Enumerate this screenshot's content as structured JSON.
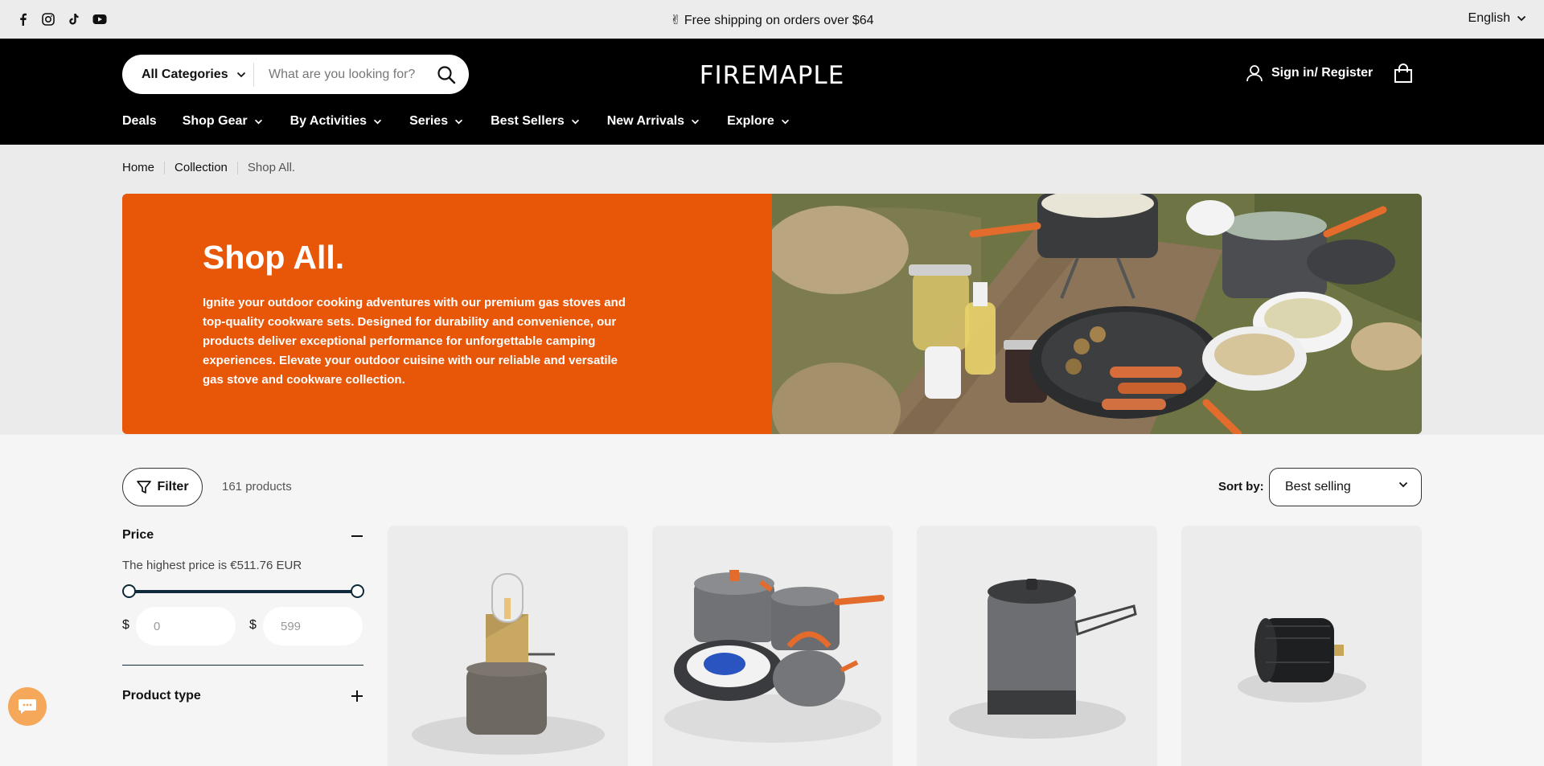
{
  "announcement": {
    "text": "Free shipping on orders over $64",
    "emoji": "✌"
  },
  "language": "English",
  "header": {
    "search": {
      "category": "All Categories",
      "placeholder": "What are you looking for?"
    },
    "logo": "FIREMAPLE",
    "account_label": "Sign in/ Register"
  },
  "nav": [
    {
      "label": "Deals"
    },
    {
      "label": "Shop Gear"
    },
    {
      "label": "By Activities"
    },
    {
      "label": "Series"
    },
    {
      "label": "Best Sellers"
    },
    {
      "label": "New Arrivals"
    },
    {
      "label": "Explore"
    }
  ],
  "breadcrumb": [
    "Home",
    "Collection",
    "Shop All."
  ],
  "hero": {
    "title": "Shop All.",
    "description": "Ignite your outdoor cooking adventures with our premium gas stoves and top-quality cookware sets. Designed for durability and convenience, our products deliver exceptional performance for unforgettable camping experiences. Elevate your outdoor cuisine with our reliable and versatile gas stove and cookware collection."
  },
  "toolbar": {
    "filter_label": "Filter",
    "product_count": "161 products",
    "sort_label": "Sort by:",
    "sort_value": "Best selling"
  },
  "filters": {
    "price": {
      "title": "Price",
      "note": "The highest price is €511.76 EUR",
      "currency": "$",
      "min_placeholder": "0",
      "max_placeholder": "599",
      "range_min_fraction": 0,
      "range_max_fraction": 1
    },
    "product_type": {
      "title": "Product type"
    }
  },
  "products": [
    {
      "image": "gas-lantern"
    },
    {
      "image": "cookware-set"
    },
    {
      "image": "heat-exchanger-pot"
    },
    {
      "image": "gas-adapter"
    }
  ],
  "colors": {
    "accent": "#e85608",
    "header_bg": "#000000",
    "slider": "#0f2a3a",
    "chat": "#f5a85a"
  }
}
